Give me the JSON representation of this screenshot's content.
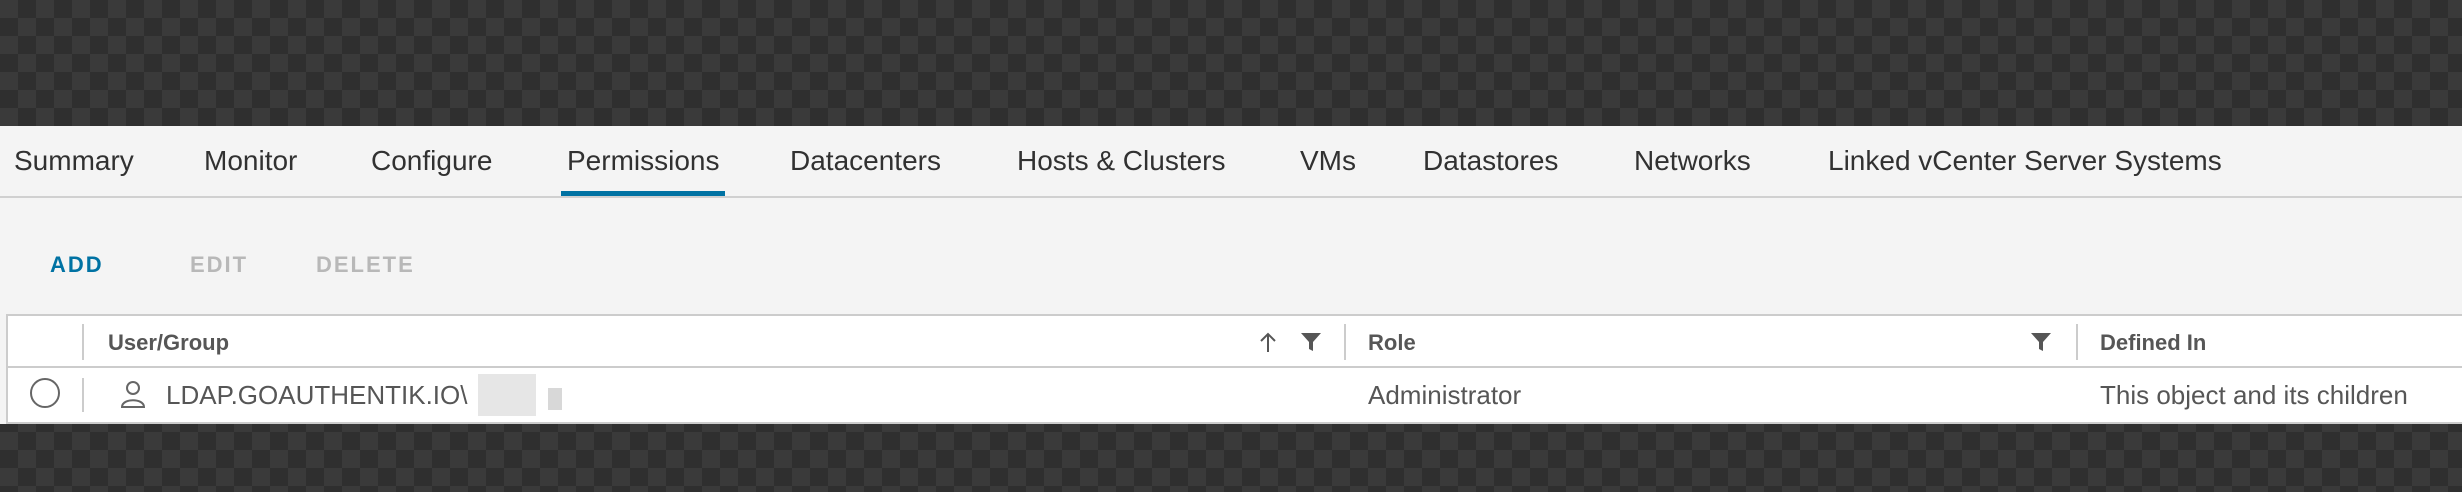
{
  "tabs": [
    {
      "label": "Summary"
    },
    {
      "label": "Monitor"
    },
    {
      "label": "Configure"
    },
    {
      "label": "Permissions",
      "active": true
    },
    {
      "label": "Datacenters"
    },
    {
      "label": "Hosts & Clusters"
    },
    {
      "label": "VMs"
    },
    {
      "label": "Datastores"
    },
    {
      "label": "Networks"
    },
    {
      "label": "Linked vCenter Server Systems"
    }
  ],
  "toolbar": {
    "add_label": "ADD",
    "edit_label": "EDIT",
    "delete_label": "DELETE"
  },
  "grid": {
    "columns": [
      {
        "label": "User/Group",
        "sorted": "ascending",
        "filterable": true
      },
      {
        "label": "Role",
        "filterable": true
      },
      {
        "label": "Defined In"
      }
    ],
    "rows": [
      {
        "user": "LDAP.GOAUTHENTIK.IO\\",
        "role": "Administrator",
        "defined_in": "This object and its children",
        "selected": false
      }
    ]
  },
  "colors": {
    "accent": "#0072a3",
    "disabled": "#b8b8b8",
    "text": "#313131"
  },
  "icons": {
    "sort": "arrow-up-icon",
    "filter": "filter-icon",
    "user": "user-icon"
  }
}
